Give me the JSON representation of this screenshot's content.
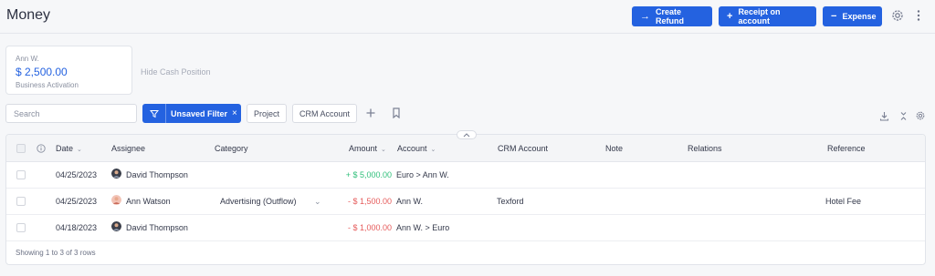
{
  "app": {
    "title": "Money"
  },
  "header_buttons": {
    "create_refund": "Create Refund",
    "receipt": "Receipt on account",
    "expense": "Expense"
  },
  "cash_position": {
    "name": "Ann W.",
    "amount": "$ 2,500.00",
    "label": "Business Activation",
    "hide_label": "Hide Cash Position"
  },
  "toolbar": {
    "search_placeholder": "Search",
    "unsaved_filter": "Unsaved Filter",
    "chips": [
      "Project",
      "CRM Account"
    ]
  },
  "table": {
    "columns": {
      "date": "Date",
      "assignee": "Assignee",
      "category": "Category",
      "amount": "Amount",
      "account": "Account",
      "crm_account": "CRM Account",
      "note": "Note",
      "relations": "Relations",
      "reference": "Reference"
    },
    "rows": [
      {
        "date": "04/25/2023",
        "assignee": "David Thompson",
        "category": "",
        "amount": "+ $ 5,000.00",
        "amount_type": "positive",
        "account": "Euro > Ann W.",
        "crm_account": "",
        "note": "",
        "relations": "",
        "reference": ""
      },
      {
        "date": "04/25/2023",
        "assignee": "Ann Watson",
        "category": "Advertising (Outflow)",
        "amount": "- $ 1,500.00",
        "amount_type": "negative",
        "account": "Ann W.",
        "crm_account": "Texford",
        "note": "",
        "relations": "",
        "reference": "Hotel Fee"
      },
      {
        "date": "04/18/2023",
        "assignee": "David Thompson",
        "category": "",
        "amount": "- $ 1,000.00",
        "amount_type": "negative",
        "account": "Ann W. > Euro",
        "crm_account": "",
        "note": "",
        "relations": "",
        "reference": ""
      }
    ],
    "footer": "Showing 1 to 3 of 3 rows"
  },
  "colors": {
    "accent": "#2462e0",
    "positive": "#2fbf7a",
    "negative": "#e55a5a"
  }
}
